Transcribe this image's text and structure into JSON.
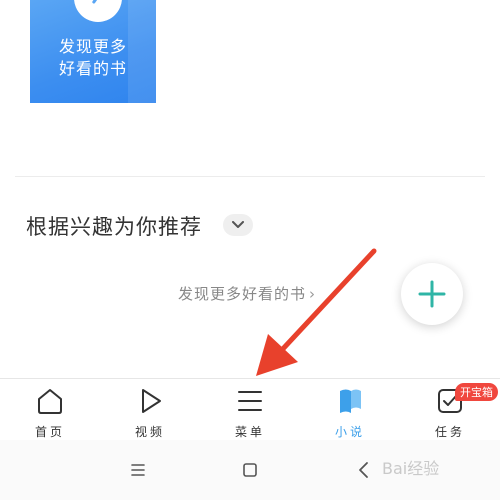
{
  "book_card": {
    "line1": "发现更多",
    "line2": "好看的书"
  },
  "recommend": {
    "title": "根据兴趣为你推荐",
    "more_link": "发现更多好看的书",
    "more_arrow": "›"
  },
  "tabbar": {
    "tabs": [
      {
        "label": "首页",
        "icon": "home-icon"
      },
      {
        "label": "视频",
        "icon": "play-icon"
      },
      {
        "label": "菜单",
        "icon": "menu-icon"
      },
      {
        "label": "小说",
        "icon": "book-icon",
        "active": true
      },
      {
        "label": "任务",
        "icon": "task-icon",
        "badge": "开宝箱"
      }
    ],
    "active_color": "#3da0ea",
    "badge_color": "#f0473e"
  },
  "annotation": {
    "arrow_color": "#e8412c"
  },
  "watermark": "Bai经验"
}
